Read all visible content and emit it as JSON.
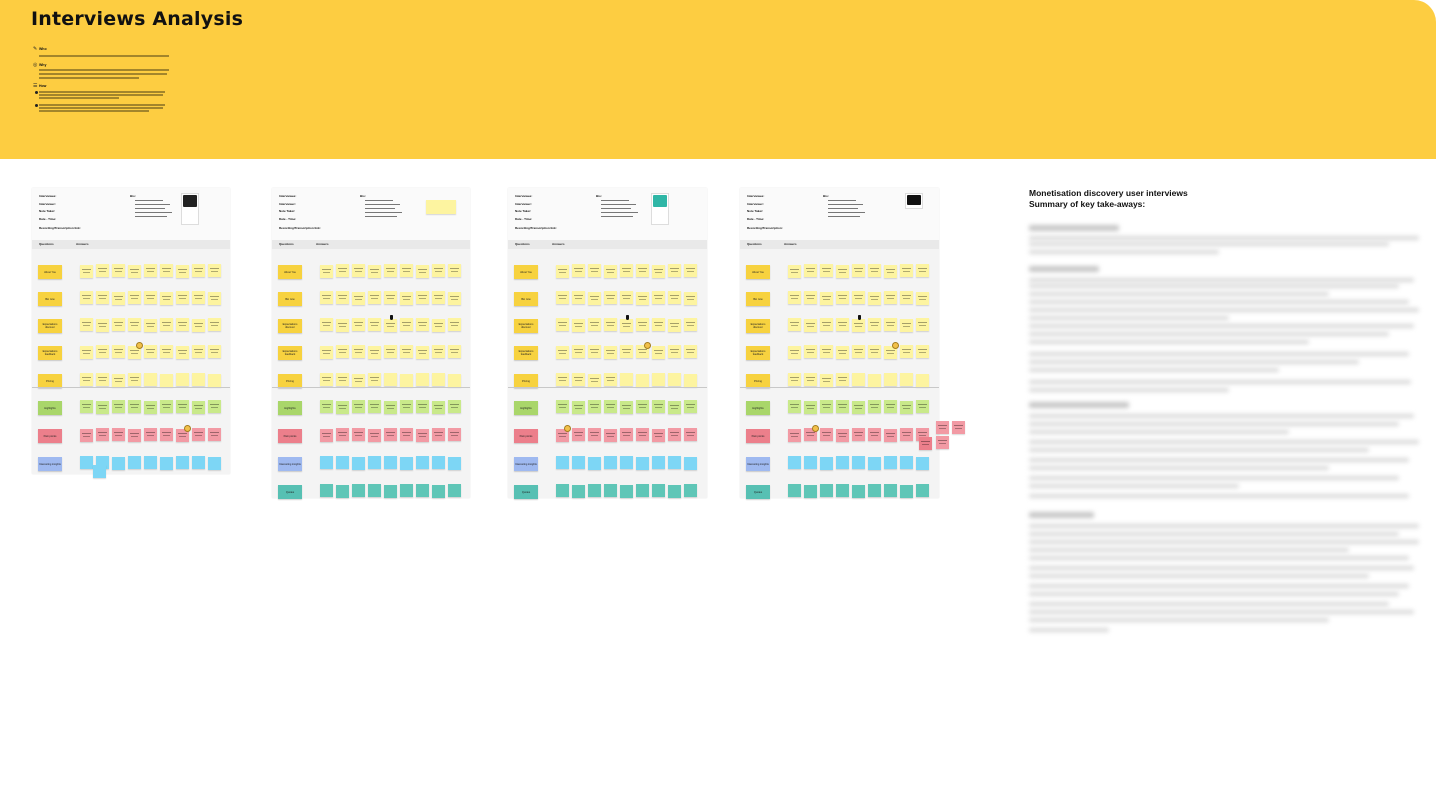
{
  "banner": {
    "title": "Interviews Analysis",
    "sections": [
      {
        "icon": "who-icon",
        "heading": "Who"
      },
      {
        "icon": "why-icon",
        "heading": "Why"
      },
      {
        "icon": "how-icon",
        "heading": "How"
      }
    ]
  },
  "boards": [
    {
      "id": "board-1",
      "fields": {
        "interviewee": "Interviewee:",
        "interviewer": "Interviewer:",
        "note_taker": "Note Taker:",
        "date_time": "Date - Time:",
        "recording": "Recording/Transcription link:"
      },
      "bio": "Bio:",
      "col_q": "Questions",
      "col_a": "Answers"
    },
    {
      "id": "board-2",
      "fields": {
        "interviewee": "Interviewee:",
        "interviewer": "Interviewer:",
        "note_taker": "Note Taker:",
        "date_time": "Date - Time:",
        "recording": "Recording/Transcription link:"
      },
      "bio": "Bio:",
      "col_q": "Questions",
      "col_a": "Answers"
    },
    {
      "id": "board-3",
      "fields": {
        "interviewee": "Interviewee:",
        "interviewer": "Interviewer:",
        "note_taker": "Note Taker:",
        "date_time": "Date - Time:",
        "recording": "Recording/Transcription link:"
      },
      "bio": "Bio:",
      "col_q": "Questions",
      "col_a": "Answers"
    },
    {
      "id": "board-4",
      "fields": {
        "interviewee": "Interviewee:",
        "interviewer": "Interviewer:",
        "note_taker": "Note Taker:",
        "date_time": "Date - Time:",
        "recording": "Recording/Transcription:"
      },
      "bio": "Bio:",
      "col_q": "Questions",
      "col_a": "Answers"
    }
  ],
  "question_labels": [
    "About You",
    "Bio now",
    "Expectations discover",
    "Expectations feedback",
    "Pricing",
    "Highlights",
    "Pain points",
    "Interesting insights",
    "Quotes"
  ],
  "summary": {
    "title_line1": "Monetisation discovery user interviews",
    "title_line2": "Summary of key take-aways:"
  },
  "colors": {
    "banner": "#fdcd41",
    "sticky_yellow": "#fdf4a0",
    "sticky_green": "#c9e98a",
    "sticky_pink": "#f29aa4",
    "sticky_blue": "#7dd6f5",
    "sticky_teal": "#5fc6b7"
  }
}
